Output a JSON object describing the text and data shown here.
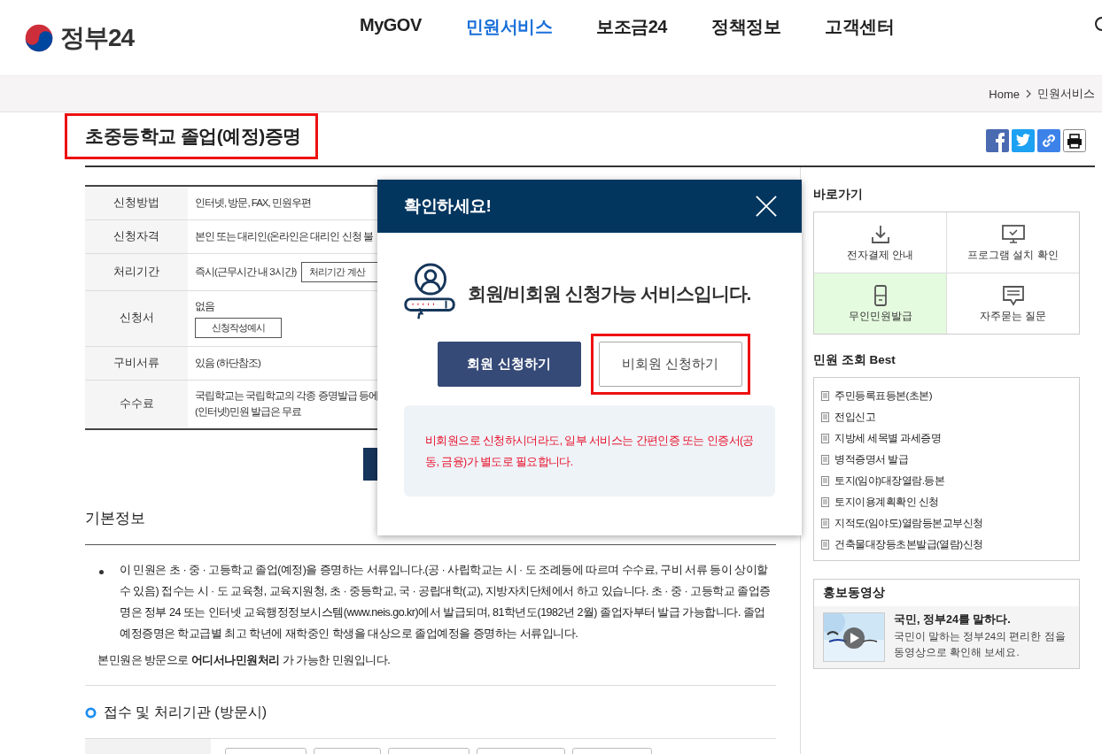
{
  "header": {
    "logo": "정부24",
    "nav": [
      {
        "label": "MyGOV",
        "selected": false
      },
      {
        "label": "민원서비스",
        "selected": true
      },
      {
        "label": "보조금24",
        "selected": false
      },
      {
        "label": "정책정보",
        "selected": false
      },
      {
        "label": "고객센터",
        "selected": false
      }
    ]
  },
  "breadcrumb": [
    "Home",
    "민원서비스"
  ],
  "page_title": {
    "text": "초중등학교 졸업(예정)증명",
    "highlighted": true
  },
  "info_table": [
    {
      "label": "신청방법",
      "value": "인터넷, 방문, FAX, 민원우편"
    },
    {
      "label": "신청자격",
      "value": "본인 또는 대리인(온라인은 대리인 신청 불"
    },
    {
      "label": "처리기간",
      "value": "즉시(근무시간 내 3시간)",
      "button": "처리기간 계산"
    },
    {
      "label": "신청서",
      "value": "없음",
      "button": "신청작성예시"
    },
    {
      "label": "구비서류",
      "value": "있음 (하단참조)"
    },
    {
      "label": "수수료",
      "value": "국립학교는 국립학교의 각종 증명발급 등에",
      "value2": "(인터넷)민원 발급은 무료"
    }
  ],
  "basic_info": {
    "heading": "기본정보",
    "bullet": "이 민원은 초 · 중 · 고등학교 졸업(예정)을 증명하는 서류입니다.(공 · 사립학교는 시 · 도 조례등에 따르며 수수료, 구비 서류 등이 상이할 수 있음) 접수는 시 · 도 교육청, 교육지원청, 초 · 중등학교, 국 · 공립대학(교), 지방자치단체에서 하고 있습니다. 초 · 중 · 고등학교 졸업증명은 정부 24 또는 인터넷 교육행정정보시스템(www.neis.go.kr)에서 발급되며, 81학년도(1982년 2월) 졸업자부터 발급 가능합니다. 졸업예정증명은 학교급별 최고 학년에 재학중인 학생을 대상으로 졸업예정을 증명하는 서류입니다.",
    "note": "본민원은 방문으로 **어디서나민원처리** 가 가능한 민원입니다."
  },
  "offices": {
    "heading": "접수 및 처리기관 (방문시)"
  },
  "sidebar": {
    "shortcuts_title": "바로가기",
    "shortcuts": [
      {
        "kind": "download",
        "label": "전자결제 안내",
        "highlighted": false
      },
      {
        "kind": "monitor",
        "label": "프로그램 설치 확인",
        "highlighted": false
      },
      {
        "kind": "kiosk",
        "label": "무인민원발급",
        "highlighted": true
      },
      {
        "kind": "chat",
        "label": "자주묻는 질문",
        "highlighted": false
      }
    ],
    "best_title": "민원 조회 Best",
    "best": [
      "주민등록표등본(초본)",
      "전입신고",
      "지방세 세목별 과세증명",
      "병적증명서 발급",
      "토지(임야)대장열람.등본",
      "토지이용계획확인 신청",
      "지적도(임야도)열람등본교부신청",
      "건축물대장등초본발급(열람)신청"
    ],
    "video": {
      "title": "홍보동영상",
      "headline": "국민, 정부24를 말하다.",
      "desc": "국민이 말하는 정부24의 편리한 점을",
      "desc2": "동영상으로 확인해 보세요."
    }
  },
  "modal": {
    "title": "확인하세요!",
    "message": "회원/비회원 신청가능 서비스입니다.",
    "buttons": [
      {
        "label": "회원 신청하기",
        "kind": "primary",
        "highlighted": false
      },
      {
        "label": "비회원 신청하기",
        "kind": "secondary",
        "highlighted": true
      }
    ],
    "notice": "비회원으로 신청하시더라도, 일부 서비스는 간편인증 또는 인증서(공동, 금융)가 별도로 필요합니다."
  }
}
